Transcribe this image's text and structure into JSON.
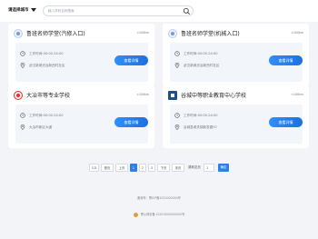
{
  "header": {
    "city": "请选择城市",
    "search_placeholder": "输入学校名称搜索"
  },
  "cards": [
    {
      "name": "鲁班名师学堂(汽修入口)",
      "distance": "<100km",
      "hours": "工作时间:00:00-24:00",
      "address": "武汉新城光谷新西村社区",
      "button": "查看详情"
    },
    {
      "name": "鲁班名师学堂(机械入口)",
      "distance": "<100km",
      "hours": "工作时间:00:00-24:00",
      "address": "武汉新城光谷新西村社区",
      "button": "查看详情"
    },
    {
      "name": "大冶市等专业学校",
      "distance": "<100km",
      "hours": "工作时间:00:00-24:00",
      "address": "大冶市新区大道",
      "button": "查看详情"
    },
    {
      "name": "谷城中等职业教育中心学校",
      "distance": "<100km",
      "hours": "工作时间:00:00-24:00",
      "address": "谷城县城关镇新发路97",
      "button": "查看详情"
    }
  ],
  "pagination": {
    "total": "1/3",
    "first": "首页",
    "prev": "上页",
    "pages": [
      "1",
      "2",
      "3"
    ],
    "next": "下页",
    "last": "末页",
    "jump_label": "跳转至页",
    "jump_value": "1",
    "go": "确定"
  },
  "footer": {
    "icp": "备案号：鄂ICP备2022000000号",
    "police": "鄂公网安备 42010000000000号"
  }
}
